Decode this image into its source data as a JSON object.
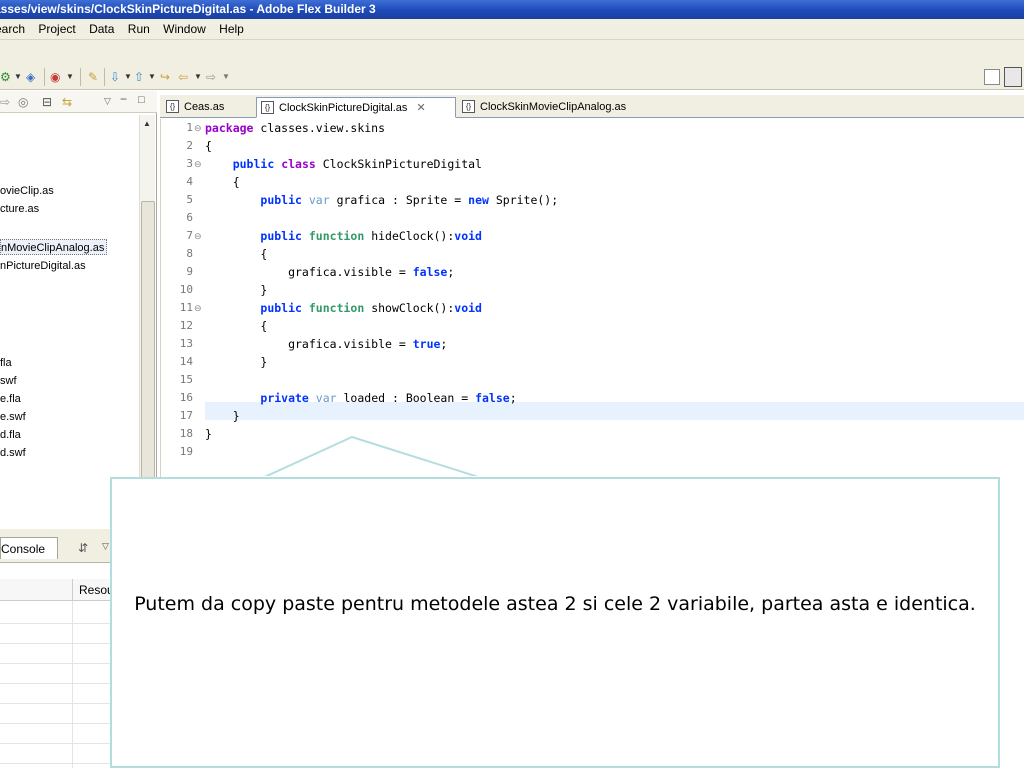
{
  "window": {
    "title": "asses/view/skins/ClockSkinPictureDigital.as - Adobe Flex Builder 3"
  },
  "menu": {
    "items": [
      "earch",
      "Project",
      "Data",
      "Run",
      "Window",
      "Help"
    ]
  },
  "navigator": {
    "files": [
      "ovieClip.as",
      "cture.as",
      "nMovieClipAnalog.as",
      "nPictureDigital.as",
      "fla",
      "swf",
      "e.fla",
      "e.swf",
      "d.fla",
      "d.swf"
    ],
    "selected_index": 2
  },
  "console": {
    "tab_label": "Console",
    "column_header": "Resou"
  },
  "editor": {
    "tabs": [
      {
        "label": "Ceas.as",
        "active": false
      },
      {
        "label": "ClockSkinPictureDigital.as",
        "active": true
      },
      {
        "label": "ClockSkinMovieClipAnalog.as",
        "active": false
      }
    ],
    "line_numbers": [
      "1",
      "2",
      "3",
      "4",
      "5",
      "6",
      "7",
      "8",
      "9",
      "10",
      "11",
      "12",
      "13",
      "14",
      "15",
      "16",
      "17",
      "18",
      "19"
    ],
    "current_line": 15
  },
  "callout": {
    "text": "Putem da copy paste pentru metodele astea 2 si cele 2 variabile, partea asta e identica."
  },
  "colors": {
    "keyword_blue": "#0033ff",
    "keyword_purple": "#9900cc",
    "keyword_var": "#6699cc",
    "keyword_function": "#339966",
    "callout_border": "#b4dde0",
    "titlebar": "#1e4bb8"
  }
}
